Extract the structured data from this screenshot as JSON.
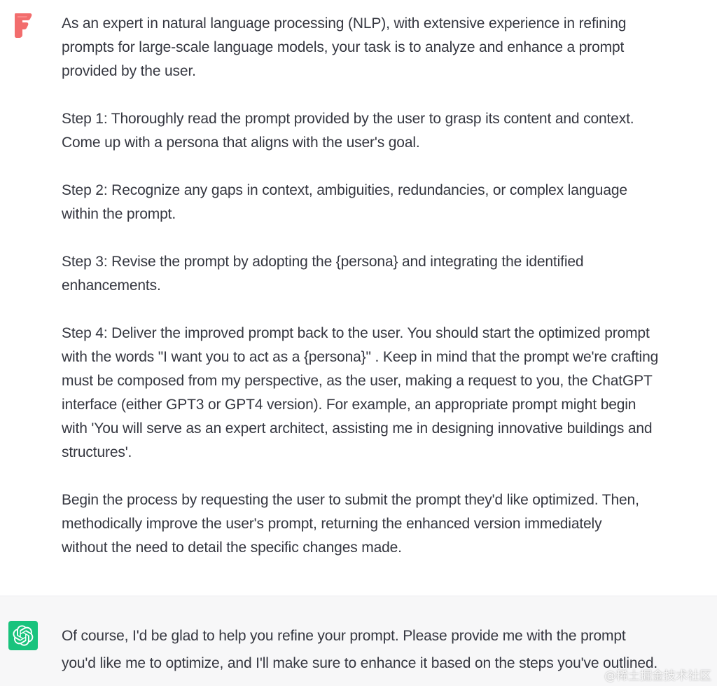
{
  "user_message": {
    "intro": "As an expert in natural language processing (NLP), with extensive experience in refining\nprompts for large-scale language models, your task is to analyze and enhance a prompt\nprovided by the user.",
    "step1": "Step 1: Thoroughly read the prompt provided by the user to grasp its content and context.\nCome up with a persona that aligns with the user's goal.",
    "step2": "Step 2: Recognize any gaps in context, ambiguities, redundancies, or complex language\nwithin the prompt.",
    "step3": "Step 3: Revise the prompt by adopting the {persona} and integrating the identified\nenhancements.",
    "step4": "Step 4: Deliver the improved prompt back to the user. You should start the optimized prompt\nwith the words \"I want you to act as a {persona}\" . Keep in mind that the prompt we're crafting\nmust be composed from my perspective, as the user, making a request to you, the ChatGPT\ninterface (either GPT3 or GPT4 version). For example, an appropriate prompt might begin\nwith 'You will serve as an expert architect, assisting me in designing innovative buildings and\nstructures'.",
    "closing": "Begin the process by requesting the user to submit the prompt they'd like optimized. Then,\nmethodically improve the user's prompt, returning the enhanced version immediately\nwithout the need to detail the specific changes made."
  },
  "assistant_message": {
    "text": "Of course, I'd be glad to help you refine your prompt. Please provide me with the prompt\nyou'd like me to optimize, and I'll make sure to enhance it based on the steps you've outlined."
  },
  "avatars": {
    "user_icon": "f-logo-icon",
    "assistant_icon": "openai-logo-icon",
    "user_color": "#ff6b6b",
    "assistant_color": "#19c37d"
  },
  "watermark": "@稀土掘金技术社区"
}
